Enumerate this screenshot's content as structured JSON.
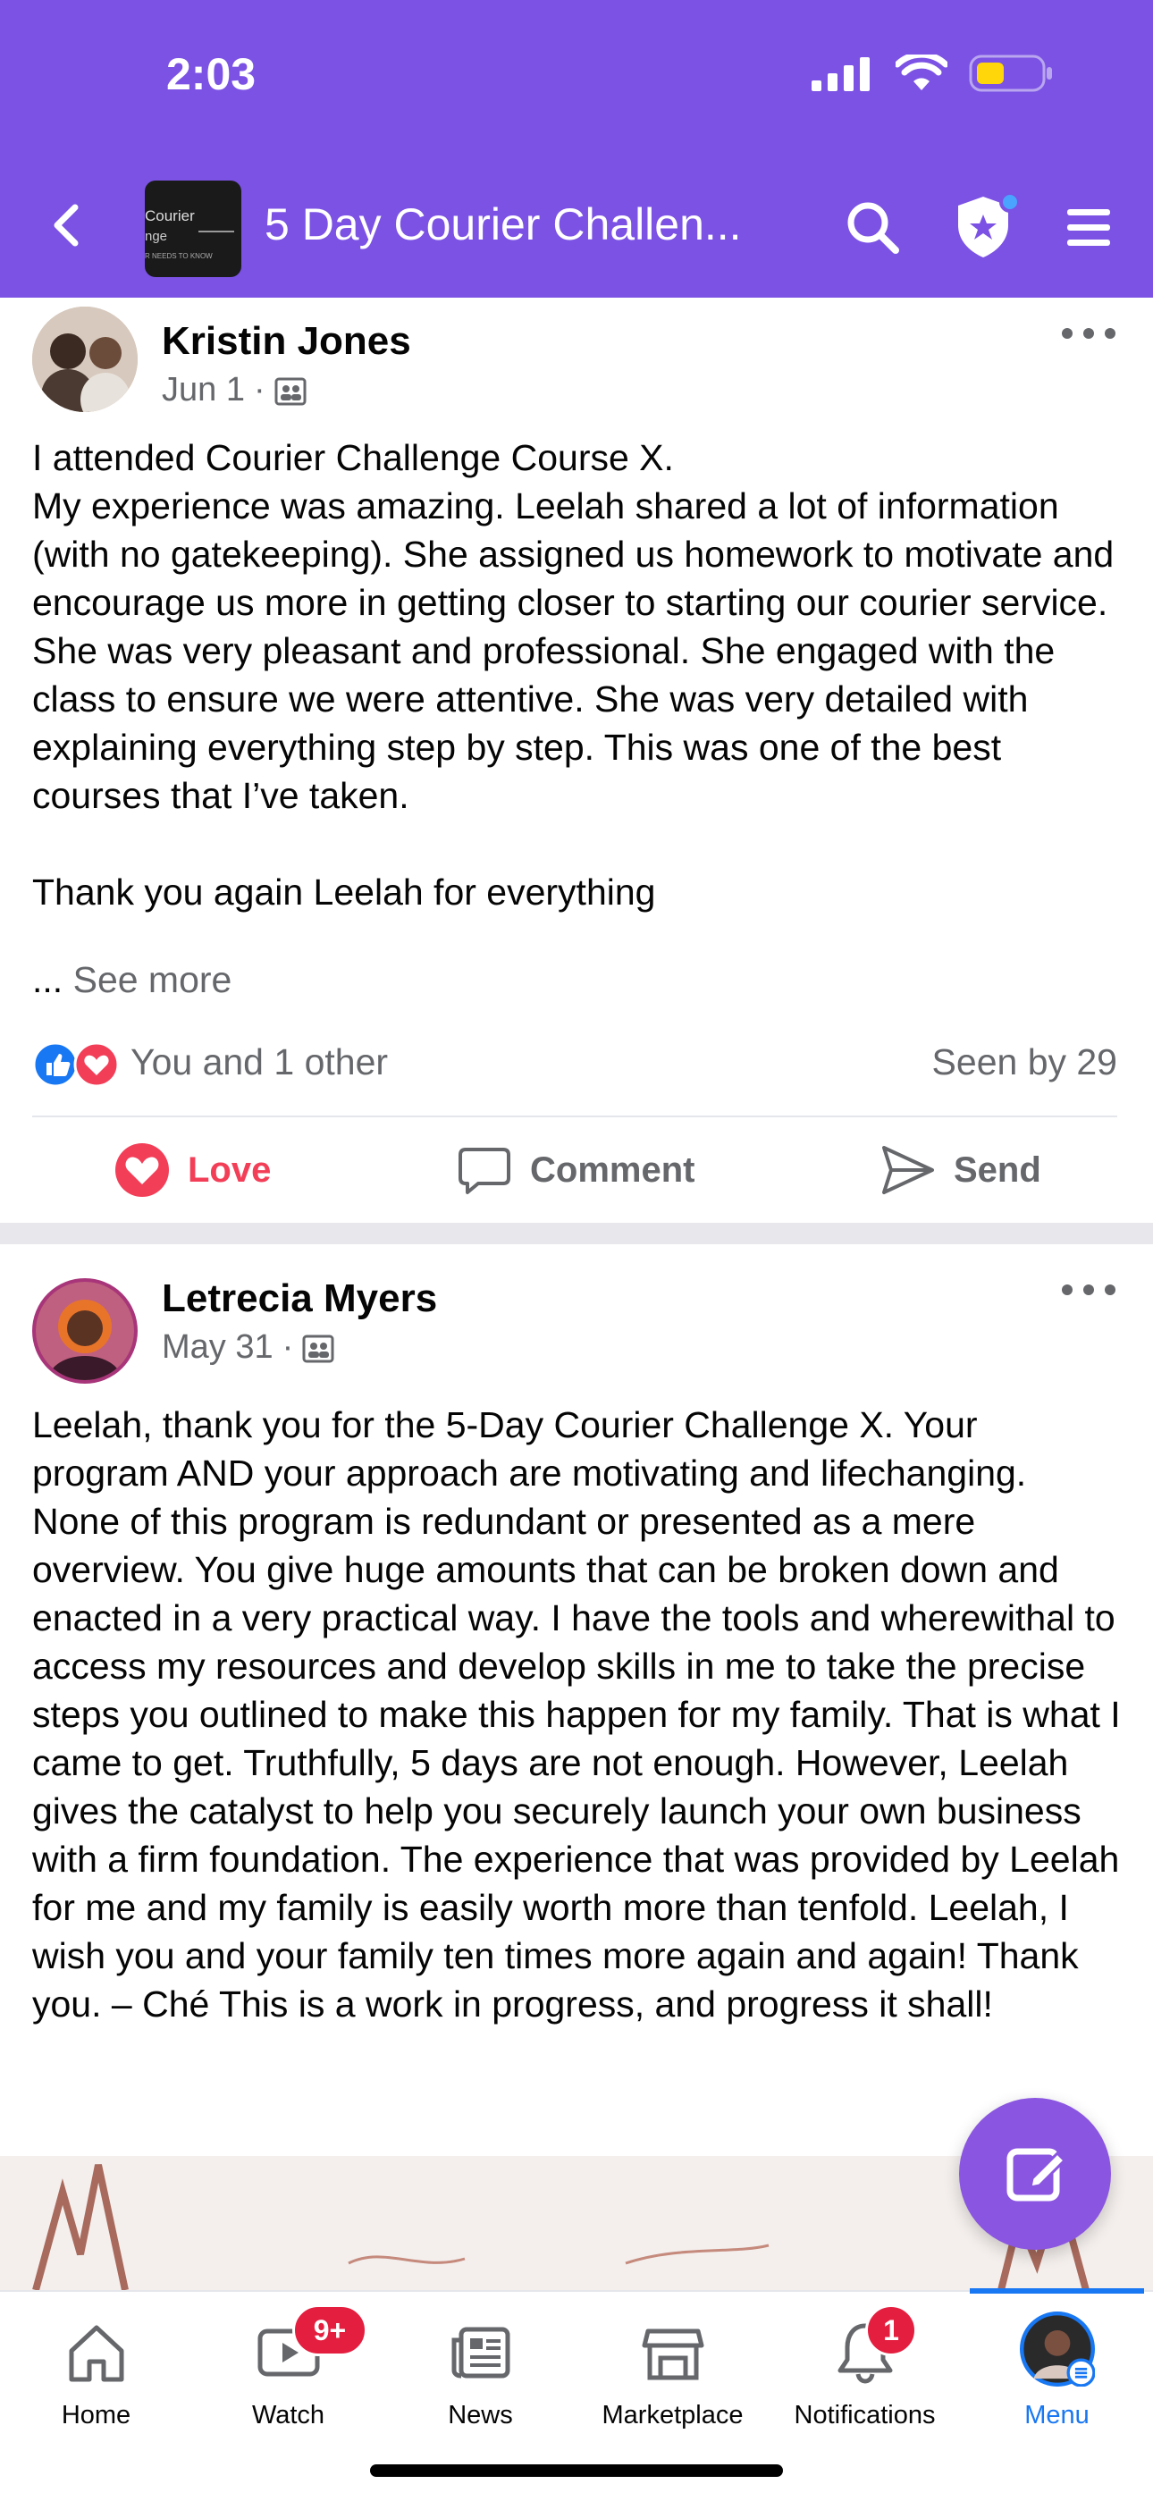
{
  "status_bar": {
    "time": "2:03"
  },
  "header": {
    "group_title": "5 Day Courier Challen...",
    "thumb_line1": "Courier",
    "thumb_line2": "nge",
    "thumb_line3": "R NEEDS TO KNOW"
  },
  "posts": [
    {
      "author": "Kristin Jones",
      "date": "Jun 1",
      "body": "I attended Courier Challenge Course X.\nMy experience was amazing. Leelah shared a lot of information (with no gatekeeping). She  assigned us homework to motivate and encourage us more in getting closer to starting our courier service. She was very pleasant and professional. She engaged with the class to ensure we were attentive. She was very detailed with explaining everything step by step. This was one of the best courses that I’ve taken.\n\nThank you again Leelah for everything",
      "ellipsis": "...",
      "see_more": "See more",
      "reactions_text": "You and 1 other",
      "seen_by": "Seen by 29",
      "actions": {
        "love": "Love",
        "comment": "Comment",
        "send": "Send"
      }
    },
    {
      "author": "Letrecia Myers",
      "date": "May 31",
      "body": "Leelah, thank you for the 5-Day Courier Challenge X. Your program AND your approach are motivating and lifechanging. None of this program is redundant or presented as a mere overview. You give huge amounts that can be broken down and enacted in a very practical way. I have the tools and wherewithal to access my resources and develop skills in me to take the precise steps you outlined to make this happen for my family. That is what I came to get. Truthfully, 5 days are not enough. However, Leelah gives the catalyst to help you securely launch your own business with a firm foundation. The experience that was provided by Leelah for me and my family is easily worth more than tenfold. Leelah, I wish you and your family ten times more again and again! Thank you. – Ché This is a work in progress, and progress it shall!"
    }
  ],
  "bottom_nav": {
    "tabs": [
      {
        "label": "Home",
        "icon": "home-icon"
      },
      {
        "label": "Watch",
        "icon": "watch-icon",
        "badge": "9+"
      },
      {
        "label": "News",
        "icon": "news-icon"
      },
      {
        "label": "Marketplace",
        "icon": "marketplace-icon"
      },
      {
        "label": "Notifications",
        "icon": "bell-icon",
        "badge": "1"
      },
      {
        "label": "Menu",
        "icon": "avatar-menu-icon",
        "active": true
      }
    ]
  },
  "colors": {
    "header": "#7b52e4",
    "active_tab": "#1877f2",
    "love": "#f33e58",
    "badge": "#e41e3f",
    "fab": "#8a55e0"
  }
}
